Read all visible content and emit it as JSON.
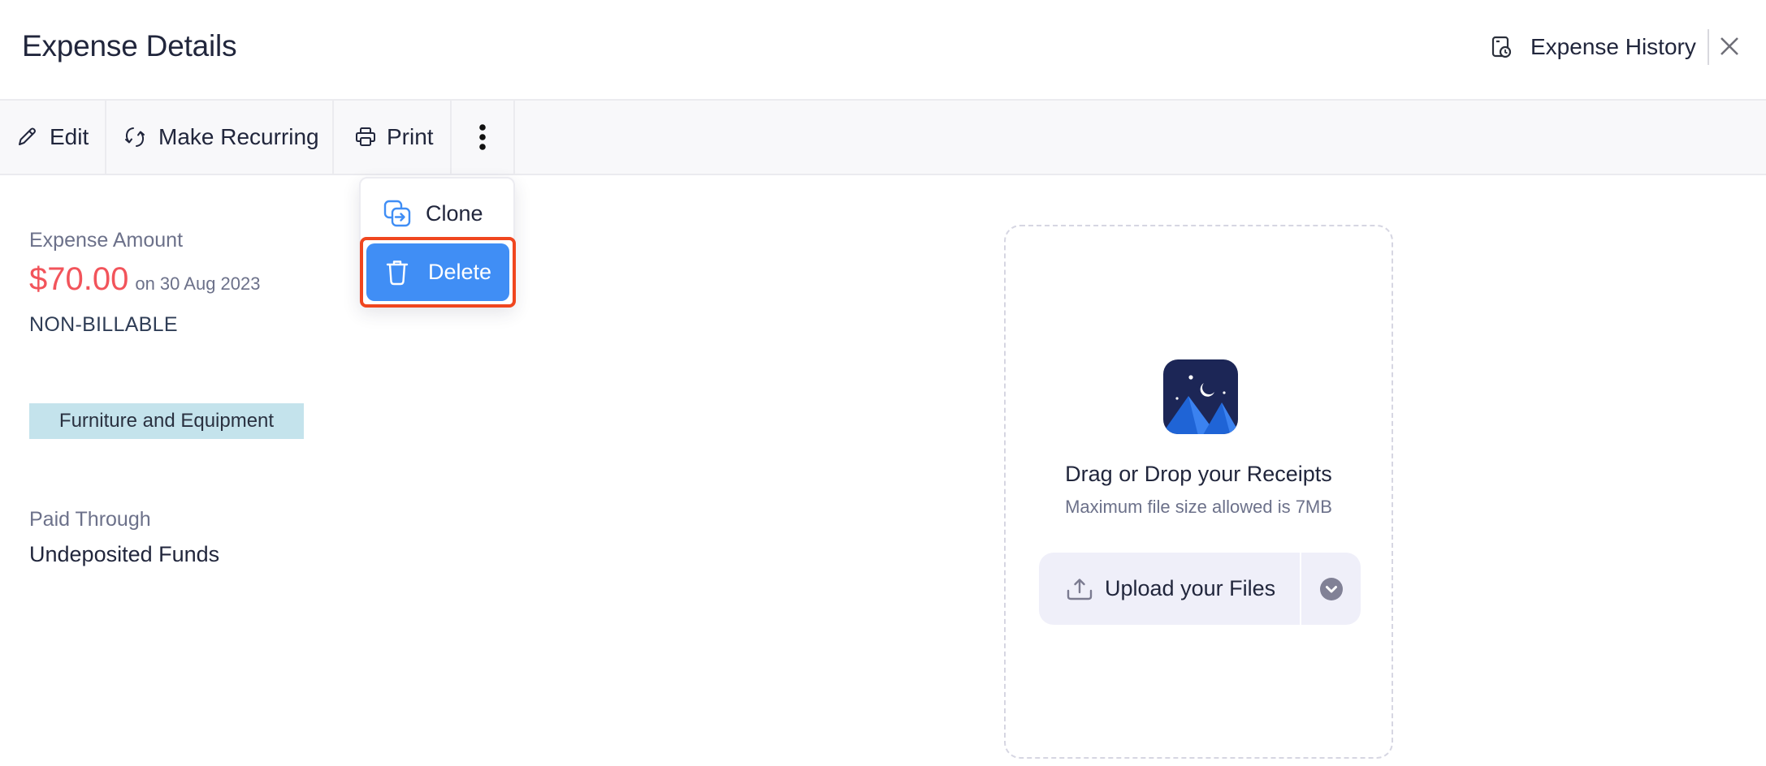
{
  "header": {
    "title": "Expense Details",
    "history_label": "Expense History",
    "history_icon": "document-clock-icon",
    "close_icon": "close-icon"
  },
  "toolbar": {
    "edit_label": "Edit",
    "recurring_label": "Make Recurring",
    "print_label": "Print",
    "more_icon": "more-vertical-icon"
  },
  "more_menu": {
    "items": [
      {
        "label": "Clone",
        "icon": "clone-icon",
        "highlighted": false
      },
      {
        "label": "Delete",
        "icon": "trash-icon",
        "highlighted": true
      }
    ]
  },
  "details": {
    "amount_label": "Expense Amount",
    "amount": "$70.00",
    "date": "on 30 Aug 2023",
    "billable_status": "NON-BILLABLE",
    "category": "Furniture and Equipment",
    "paid_through_label": "Paid Through",
    "paid_through": "Undeposited Funds"
  },
  "receipts": {
    "title": "Drag or Drop your Receipts",
    "subtitle": "Maximum file size allowed is 7MB",
    "upload_label": "Upload your Files"
  },
  "colors": {
    "amount": "#f2545b",
    "accent": "#408ef5",
    "highlight_outline": "#f0461f",
    "category_bg": "#c4e3ec"
  }
}
